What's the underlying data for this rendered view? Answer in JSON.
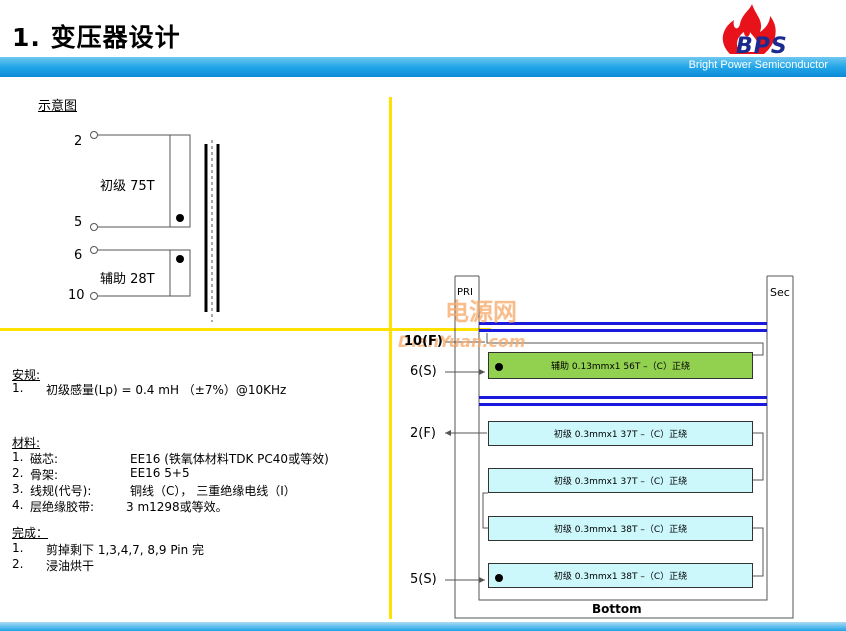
{
  "header": {
    "title": "1. 变压器设计",
    "logo_text": "BPS",
    "company": "Bright Power Semiconductor"
  },
  "schematic": {
    "label": "示意图",
    "pins": [
      "2",
      "5",
      "6",
      "10"
    ],
    "primary": "初级 75T",
    "auxiliary": "辅助 28T"
  },
  "safety": {
    "heading": "安规:",
    "items": [
      {
        "num": "1.",
        "text": "初级感量(Lp) = 0.4 mH （±7%）@10KHz"
      }
    ]
  },
  "materials": {
    "heading": "材料:",
    "items": [
      {
        "num": "1.",
        "name": "磁芯:",
        "value": "EE16 (铁氧体材料TDK PC40或等效)"
      },
      {
        "num": "2.",
        "name": "骨架:",
        "value": "EE16  5+5"
      },
      {
        "num": "3.",
        "name": "线规(代号):",
        "value": "铜线（C）， 三重绝缘电线（I）"
      },
      {
        "num": "4.",
        "name": "层绝缘胶带:",
        "value": "3 m1298或等效。"
      }
    ]
  },
  "finish": {
    "heading": "完成：",
    "items": [
      {
        "num": "1.",
        "text": "剪掉剩下 1,3,4,7, 8,9 Pin 完"
      },
      {
        "num": "2.",
        "text": "浸油烘干"
      }
    ]
  },
  "winding": {
    "pri_label": "PRI",
    "sec_label": "Sec",
    "bottom_label": "Bottom",
    "watermark_cn": "电源网",
    "watermark_url": "DianYuan.com",
    "pins": [
      "10(F)",
      "6(S)",
      "2(F)",
      "5(S)"
    ],
    "layers": [
      {
        "text": "辅助 0.13mmx1   56T –（C）正绕",
        "kind": "aux"
      },
      {
        "text": "初级 0.3mmx1  37T –（C）正绕",
        "kind": "pri"
      },
      {
        "text": "初级 0.3mmx1  37T –（C）正绕",
        "kind": "pri"
      },
      {
        "text": "初级 0.3mmx1  38T –（C）正绕",
        "kind": "pri"
      },
      {
        "text": "初级 0.3mmx1  38T –（C）正绕",
        "kind": "pri"
      }
    ]
  },
  "colors": {
    "accent_bar": "#1fa3e6",
    "divider": "#ffe100",
    "tape": "#1a1adc",
    "aux_layer": "#92d050",
    "pri_layer": "#ccf7fb",
    "logo_red": "#e8121b"
  }
}
